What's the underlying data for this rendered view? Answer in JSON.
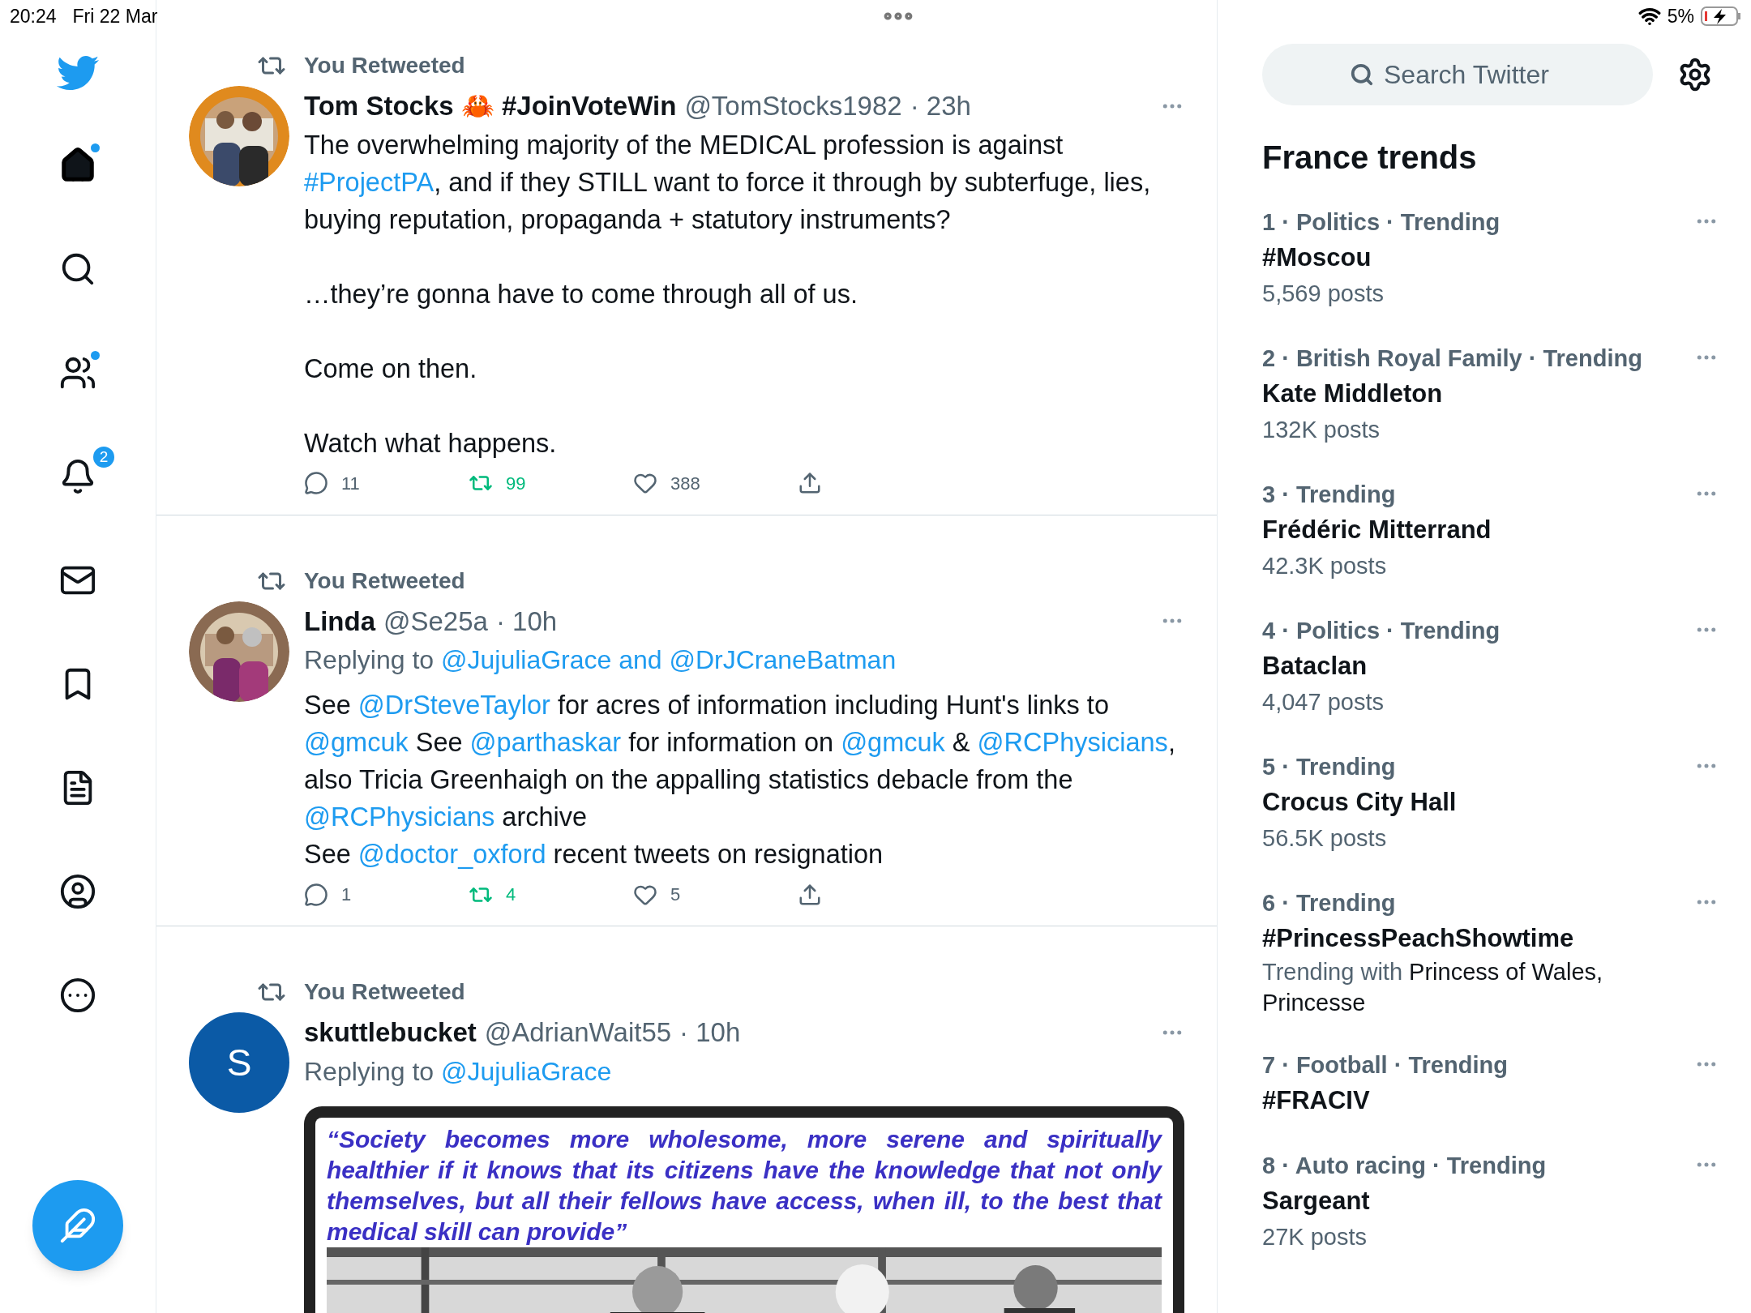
{
  "status_bar": {
    "time": "20:24",
    "date": "Fri 22 Mar",
    "battery": "5%"
  },
  "nav": [
    {
      "kind": "home",
      "selected": true,
      "unread": true
    },
    {
      "kind": "search",
      "selected": false,
      "unread": false
    },
    {
      "kind": "communities",
      "selected": false,
      "unread": true
    },
    {
      "kind": "notifications",
      "selected": false,
      "unread": false,
      "badge": "2"
    },
    {
      "kind": "messages",
      "selected": false,
      "unread": false
    },
    {
      "kind": "bookmarks",
      "selected": false,
      "unread": false
    },
    {
      "kind": "lists",
      "selected": false,
      "unread": false
    },
    {
      "kind": "profile",
      "selected": false,
      "unread": false
    },
    {
      "kind": "more",
      "selected": false,
      "unread": false
    }
  ],
  "tweets": [
    {
      "context": "You Retweeted",
      "name": "Tom Stocks 🦀 #JoinVoteWin",
      "handle": "@TomStocks1982",
      "time": "· 23h",
      "avatar": {
        "kind": "picture"
      },
      "paragraphs": [
        [
          {
            "kind": "text",
            "text": "The overwhelming majority of the MEDICAL profession is against "
          },
          {
            "kind": "link",
            "text": "#ProjectPA"
          },
          {
            "kind": "text",
            "text": ", and if they STILL want to force it through by subterfuge, lies, buying reputation, propaganda + statutory instruments?"
          }
        ],
        [
          {
            "kind": "text",
            "text": "…they’re gonna have to come through all of us."
          }
        ],
        [
          {
            "kind": "text",
            "text": "Come on then."
          }
        ],
        [
          {
            "kind": "text",
            "text": "Watch what happens."
          }
        ]
      ],
      "actions": {
        "replies": "11",
        "retweets": "99",
        "likes": "388",
        "retweeted": true,
        "liked": false
      }
    },
    {
      "context": "You Retweeted",
      "name": "Linda",
      "handle": "@Se25a",
      "time": "· 10h",
      "avatar": {
        "kind": "picture"
      },
      "replying_label": "Replying to",
      "replying_to": "@JujuliaGrace and @DrJCraneBatman",
      "paragraphs": [
        [
          {
            "kind": "text",
            "text": "See "
          },
          {
            "kind": "link",
            "text": "@DrSteveTaylor"
          },
          {
            "kind": "text",
            "text": " for acres of information including Hunt's links to "
          },
          {
            "kind": "link",
            "text": "@gmcuk"
          },
          {
            "kind": "text",
            "text": " See "
          },
          {
            "kind": "link",
            "text": "@parthaskar"
          },
          {
            "kind": "text",
            "text": " for information on "
          },
          {
            "kind": "link",
            "text": "@gmcuk"
          },
          {
            "kind": "text",
            "text": " & "
          },
          {
            "kind": "link",
            "text": "@RCPhysicians"
          },
          {
            "kind": "text",
            "text": ", also Tricia Greenhaigh on the appalling statistics debacle from the "
          },
          {
            "kind": "link",
            "text": "@RCPhysicians"
          },
          {
            "kind": "text",
            "text": " archive\nSee "
          },
          {
            "kind": "link",
            "text": "@doctor_oxford"
          },
          {
            "kind": "text",
            "text": " recent tweets on resignation"
          }
        ]
      ],
      "actions": {
        "replies": "1",
        "retweets": "4",
        "likes": "5",
        "retweeted": true,
        "liked": false
      }
    },
    {
      "context": "You Retweeted",
      "name": "skuttlebucket",
      "handle": "@AdrianWait55",
      "time": "· 10h",
      "avatar": {
        "kind": "letter",
        "letter": "S",
        "color": "#0b5aa6"
      },
      "replying_label": "Replying to",
      "replying_to": "@JujuliaGrace",
      "media": {
        "quote": "“Society becomes more wholesome, more serene and spiritually healthier if it knows that its citizens have the knowledge that not only themselves, but all their fellows have access, when ill, to the best that medical skill can provide”"
      }
    }
  ],
  "search": {
    "placeholder": "Search Twitter"
  },
  "trends": {
    "title": "France trends",
    "items": [
      {
        "meta": "1 · Politics · Trending",
        "topic": "#Moscou",
        "posts": "5,569 posts"
      },
      {
        "meta": "2 · British Royal Family · Trending",
        "topic": "Kate Middleton",
        "posts": "132K posts"
      },
      {
        "meta": "3 · Trending",
        "topic": "Frédéric Mitterrand",
        "posts": "42.3K posts"
      },
      {
        "meta": "4 · Politics · Trending",
        "topic": "Bataclan",
        "posts": "4,047 posts"
      },
      {
        "meta": "5 · Trending",
        "topic": "Crocus City Hall",
        "posts": "56.5K posts"
      },
      {
        "meta": "6 · Trending",
        "topic": "#PrincessPeachShowtime",
        "with_label": "Trending with",
        "with": "Princess of Wales, Princesse"
      },
      {
        "meta": "7 · Football · Trending",
        "topic": "#FRACIV"
      },
      {
        "meta": "8 · Auto racing · Trending",
        "topic": "Sargeant",
        "posts": "27K posts"
      }
    ]
  }
}
